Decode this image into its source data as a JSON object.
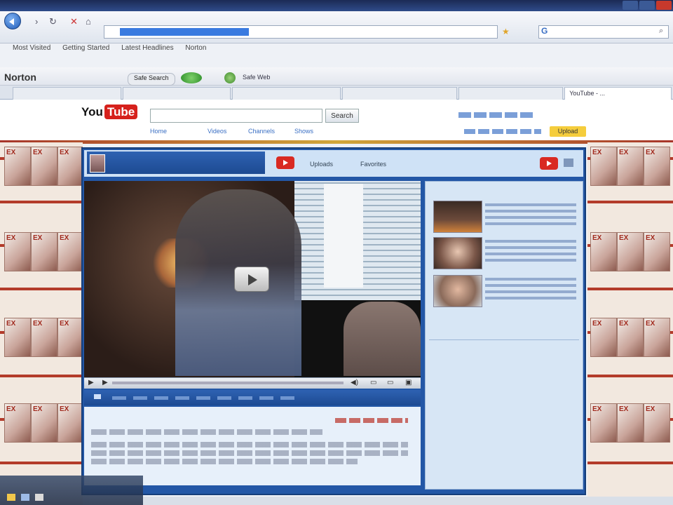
{
  "browser": {
    "title": "",
    "search_engine_label": "",
    "bookmarks": [
      "Most Visited",
      "Getting Started",
      "Latest Headlines",
      "Norton"
    ],
    "norton": {
      "label": "Norton",
      "badges": [
        "Safe Search",
        "Safe Web"
      ]
    },
    "tabs": [
      "",
      "",
      "",
      "",
      "",
      "YouTube - ..."
    ]
  },
  "youtube": {
    "logo_you": "You",
    "logo_tube": "Tube",
    "search_button": "Search",
    "nav": [
      "Home",
      "Videos",
      "Channels",
      "Shows"
    ],
    "upload": "Upload"
  },
  "channel": {
    "title": "",
    "tabs": [
      "Uploads",
      "Favorites"
    ],
    "video_title": "",
    "subscribers_heading": "",
    "friends_heading": "",
    "more_link": ""
  },
  "colors": {
    "youtube_red": "#d6211c",
    "channel_blue": "#2357a6",
    "panel_light": "#d7e6f5"
  },
  "icons": [
    "back-arrow-icon",
    "reload-icon",
    "home-icon",
    "play-icon",
    "youtube-icon"
  ]
}
